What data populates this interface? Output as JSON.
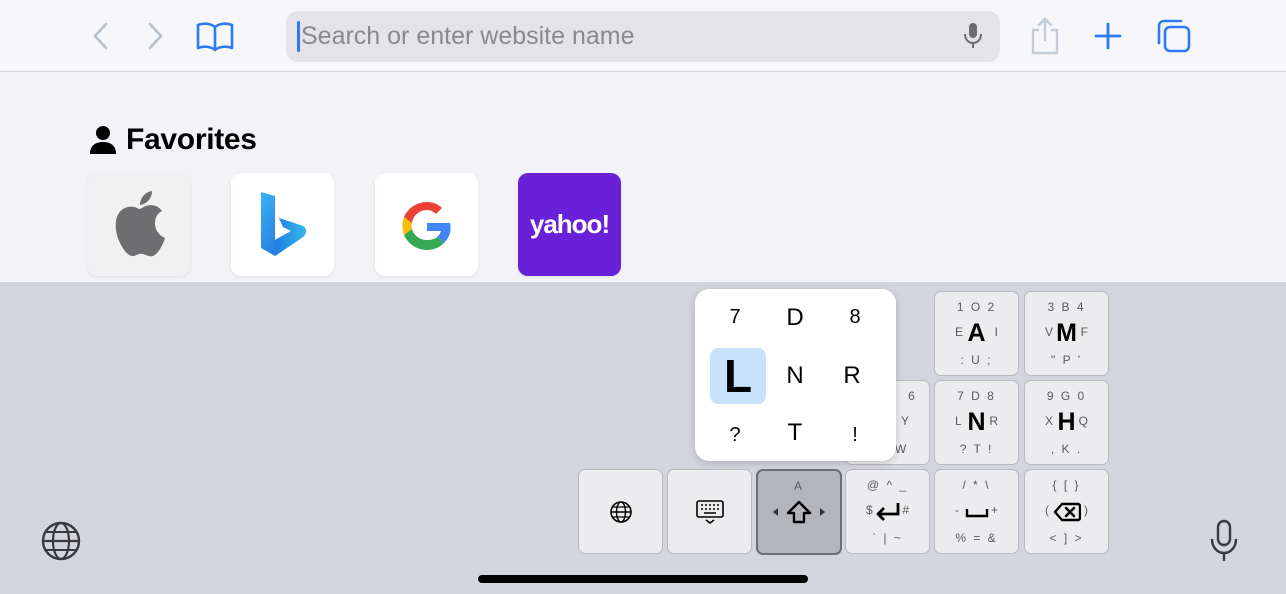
{
  "toolbar": {
    "back_icon": "chevron-left-icon",
    "forward_icon": "chevron-right-icon",
    "bookmarks_icon": "book-icon",
    "search": {
      "placeholder": "Search or enter website name",
      "value": ""
    },
    "mic_icon": "microphone-icon",
    "share_icon": "share-icon",
    "new_tab_icon": "plus-icon",
    "tabs_icon": "tabs-icon",
    "accent_color": "#2b7bf3"
  },
  "favorites": {
    "title": "Favorites",
    "items": [
      {
        "name": "Apple"
      },
      {
        "name": "Bing"
      },
      {
        "name": "Google"
      },
      {
        "name": "Yahoo",
        "logo_text": "yahoo!"
      }
    ]
  },
  "keyboard": {
    "popup": {
      "selected": "L",
      "cells": [
        "7",
        "D",
        "8",
        "L",
        "N",
        "R",
        "?",
        "T",
        "!"
      ]
    },
    "keys": {
      "a": {
        "top": "1 O 2",
        "left": "E",
        "center": "A",
        "right": "I",
        "bottom": ": U ;"
      },
      "m": {
        "top": "3 B 4",
        "left": "V",
        "center": "M",
        "right": "F",
        "bottom": "\" P '"
      },
      "y": {
        "right": "Y",
        "bottom": "W",
        "top": "6"
      },
      "n": {
        "top": "7 D 8",
        "left": "L",
        "center": "N",
        "right": "R",
        "bottom": "? T !"
      },
      "h": {
        "top": "9 G 0",
        "left": "X",
        "center": "H",
        "right": "Q",
        "bottom": ", K ."
      },
      "shift": {
        "top": "A"
      },
      "return": {
        "top": "@ ^ _",
        "left": "$",
        "right": "#",
        "bottom": "` | ~"
      },
      "space": {
        "top": "/ * \\",
        "left": "-",
        "right": "+",
        "bottom": "% = &"
      },
      "delete": {
        "top": "{ [ }",
        "left": "(",
        "right": ")",
        "bottom": "< ] >"
      }
    },
    "icons": {
      "globe": "globe-icon",
      "keyboard": "keyboard-icon",
      "shift": "shift-icon",
      "return": "return-icon",
      "space": "space-icon",
      "delete": "delete-icon",
      "dictation": "microphone-icon"
    }
  }
}
